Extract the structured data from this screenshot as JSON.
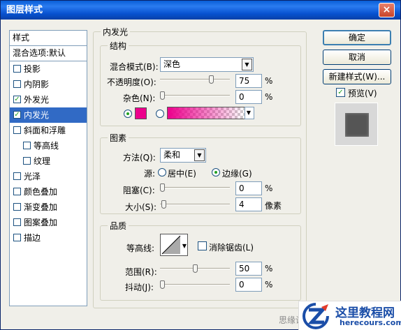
{
  "window": {
    "title": "图层样式",
    "close_glyph": "×"
  },
  "style_list": {
    "header": "样式",
    "blend_options": "混合选项:默认",
    "items": [
      {
        "label": "投影",
        "checked": false,
        "sub": false
      },
      {
        "label": "内阴影",
        "checked": false,
        "sub": false
      },
      {
        "label": "外发光",
        "checked": true,
        "sub": false
      },
      {
        "label": "内发光",
        "checked": true,
        "sub": false,
        "active": true
      },
      {
        "label": "斜面和浮雕",
        "checked": false,
        "sub": false
      },
      {
        "label": "等高线",
        "checked": false,
        "sub": true
      },
      {
        "label": "纹理",
        "checked": false,
        "sub": true
      },
      {
        "label": "光泽",
        "checked": false,
        "sub": false
      },
      {
        "label": "颜色叠加",
        "checked": false,
        "sub": false
      },
      {
        "label": "渐变叠加",
        "checked": false,
        "sub": false
      },
      {
        "label": "图案叠加",
        "checked": false,
        "sub": false
      },
      {
        "label": "描边",
        "checked": false,
        "sub": false
      }
    ]
  },
  "panel": {
    "title": "内发光",
    "structure": {
      "title": "结构",
      "blend_mode_label": "混合模式(B):",
      "blend_mode_value": "深色",
      "opacity_label": "不透明度(O):",
      "opacity_value": "75",
      "opacity_level": 75,
      "noise_label": "杂色(N):",
      "noise_value": "0",
      "noise_level": 0,
      "percent": "%",
      "color": "#ec008c"
    },
    "elements": {
      "title": "图素",
      "technique_label": "方法(Q):",
      "technique_value": "柔和",
      "source_label": "源:",
      "source_center": "居中(E)",
      "source_edge": "边缘(G)",
      "choke_label": "阻塞(C):",
      "choke_value": "0",
      "choke_level": 0,
      "size_label": "大小(S):",
      "size_value": "4",
      "size_unit": "像素",
      "size_level": 2,
      "percent": "%"
    },
    "quality": {
      "title": "品质",
      "contour_label": "等高线:",
      "anti_alias_label": "消除锯齿(L)",
      "range_label": "范围(R):",
      "range_value": "50",
      "range_level": 50,
      "jitter_label": "抖动(J):",
      "jitter_value": "0",
      "jitter_level": 0,
      "percent": "%"
    }
  },
  "buttons": {
    "ok": "确定",
    "cancel": "取消",
    "new_style": "新建样式(W)...",
    "preview_label": "预览(V)"
  },
  "footer_text": "思缘设",
  "watermark": {
    "title": "这里教程网",
    "url": "herecours.com"
  },
  "icons": {
    "dropdown": "chevron-down-icon",
    "check": "check-icon",
    "window_close": "close-icon"
  }
}
